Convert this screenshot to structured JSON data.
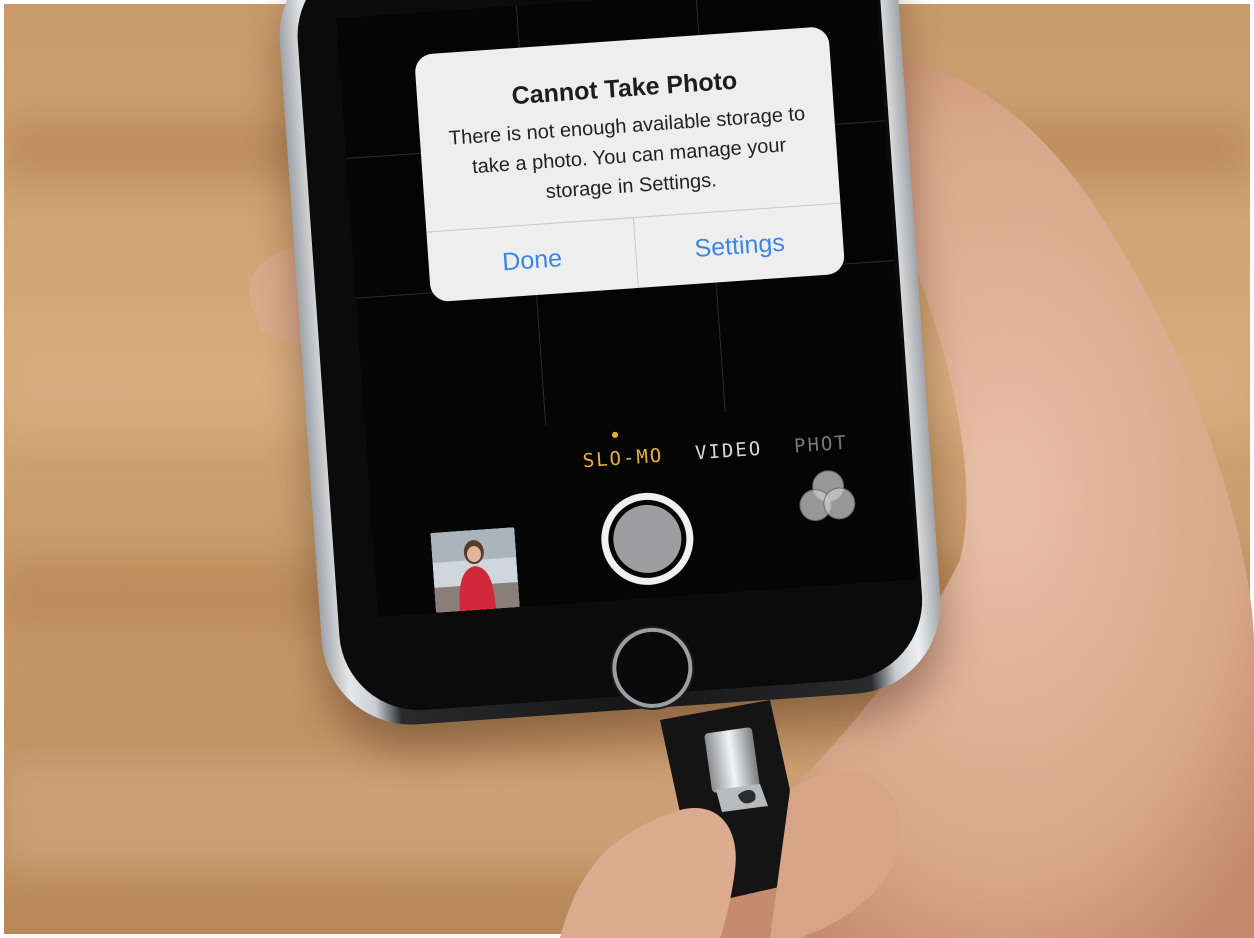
{
  "alert": {
    "title": "Cannot Take Photo",
    "message": "There is not enough available storage to take a photo. You can manage your storage in Settings.",
    "buttons": [
      "Done",
      "Settings"
    ]
  },
  "camera": {
    "modes": [
      "SLO-MO",
      "VIDEO",
      "PHOT"
    ],
    "active_mode": "SLO-MO"
  },
  "colors": {
    "alert_button": "#3a86e8",
    "active_mode": "#e9b42c"
  },
  "icons": [
    "shutter-icon",
    "filters-icon",
    "home-button-icon",
    "thumbnail-photo"
  ]
}
